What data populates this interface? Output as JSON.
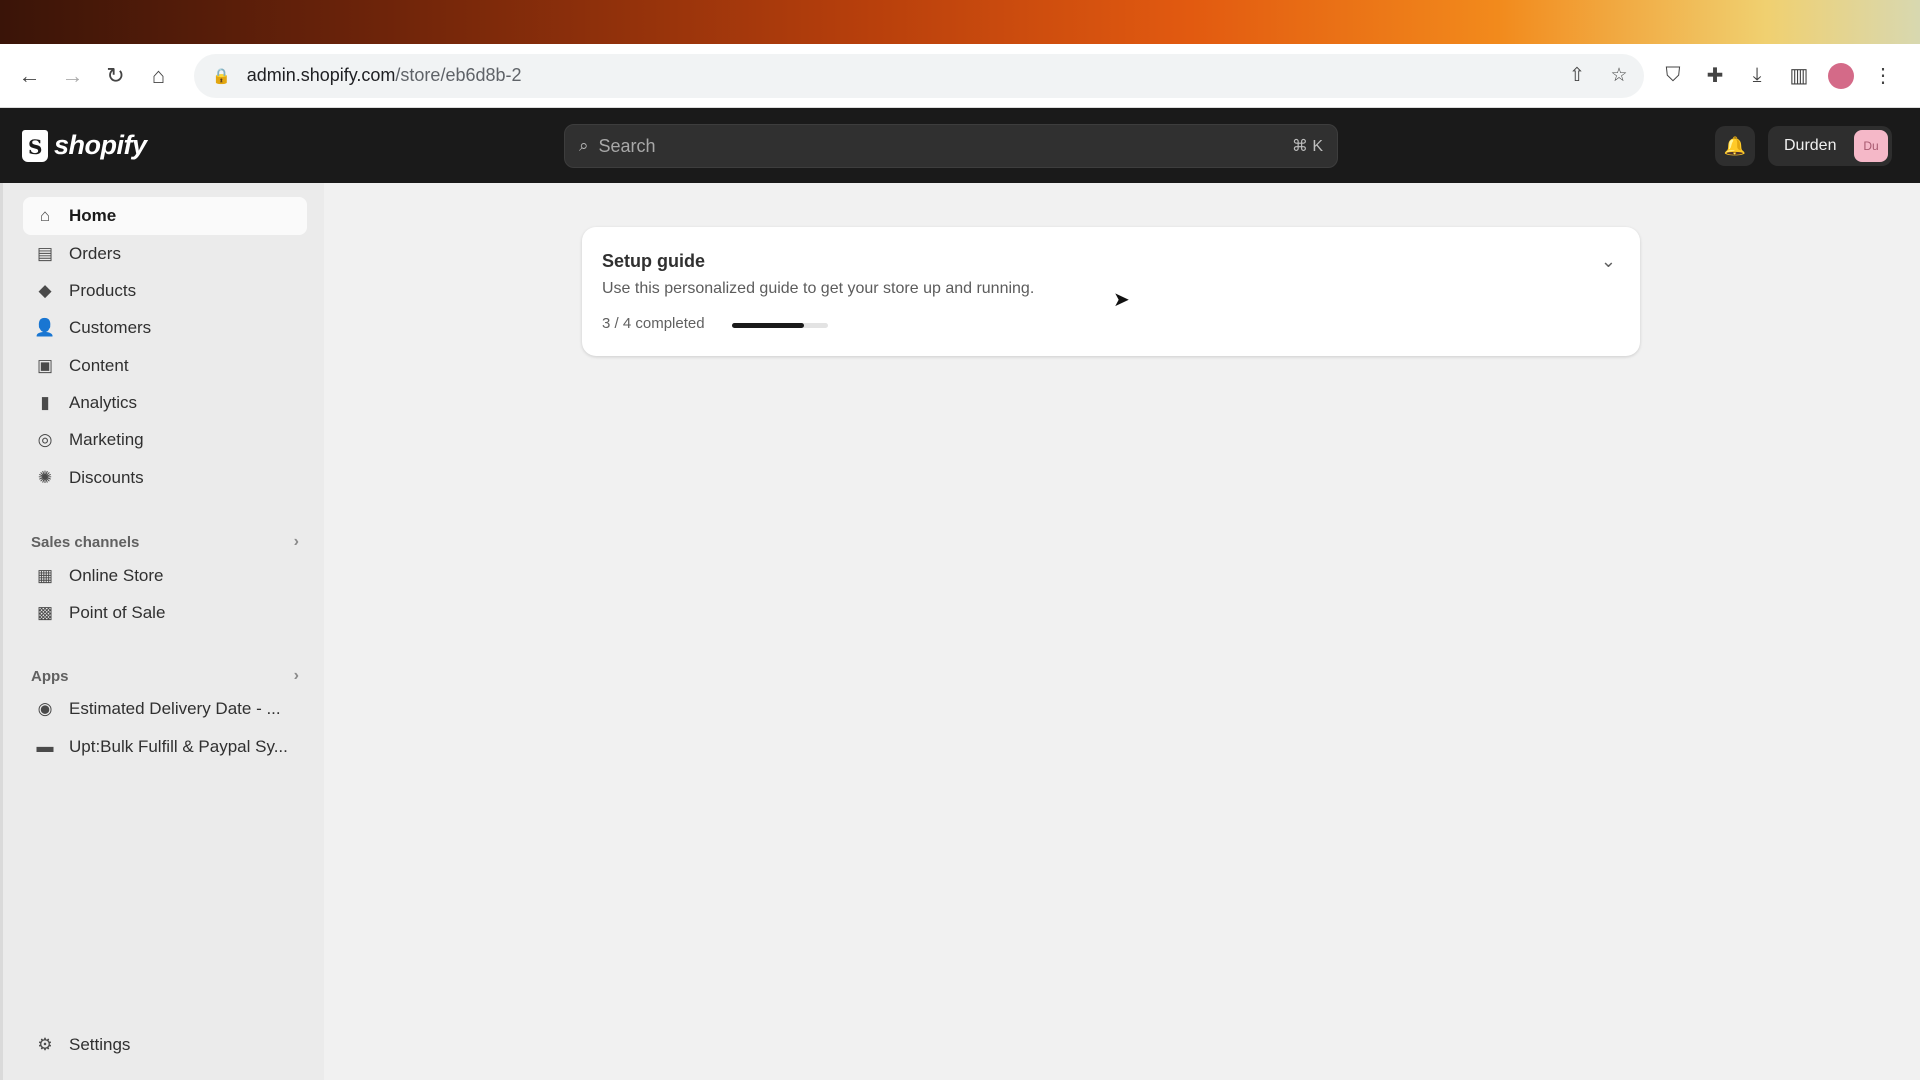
{
  "browser": {
    "url_host": "admin.shopify.com",
    "url_path": "/store/eb6d8b-2",
    "nav_icons": [
      "back-arrow-icon",
      "forward-arrow-icon",
      "reload-icon",
      "home-icon"
    ],
    "omnibox_icons": [
      "share-icon",
      "star-icon"
    ],
    "toolbar_icons": [
      "shield-extension-icon",
      "puzzle-extensions-icon",
      "download-icon",
      "sidepanel-icon",
      "profile-avatar",
      "kebab-menu-icon"
    ]
  },
  "header": {
    "logo_text": "shopify",
    "search_placeholder": "Search",
    "search_shortcut": "⌘ K",
    "user_name": "Durden",
    "user_initials": "Du"
  },
  "sidebar": {
    "main_items": [
      {
        "label": "Home",
        "icon": "home-icon",
        "active": true
      },
      {
        "label": "Orders",
        "icon": "inbox-icon"
      },
      {
        "label": "Products",
        "icon": "tag-icon"
      },
      {
        "label": "Customers",
        "icon": "person-icon"
      },
      {
        "label": "Content",
        "icon": "content-icon"
      },
      {
        "label": "Analytics",
        "icon": "bar-chart-icon"
      },
      {
        "label": "Marketing",
        "icon": "target-icon"
      },
      {
        "label": "Discounts",
        "icon": "discount-icon"
      }
    ],
    "sales_channels_label": "Sales channels",
    "sales_channels": [
      {
        "label": "Online Store",
        "icon": "store-icon"
      },
      {
        "label": "Point of Sale",
        "icon": "pos-icon"
      }
    ],
    "apps_label": "Apps",
    "apps": [
      {
        "label": "Estimated Delivery Date - ...",
        "icon": "app-icon"
      },
      {
        "label": "Upt:Bulk Fulfill & Paypal Sy...",
        "icon": "app-icon"
      }
    ],
    "settings_label": "Settings"
  },
  "setup_guide": {
    "title": "Setup guide",
    "description": "Use this personalized guide to get your store up and running.",
    "progress_text": "3 / 4 completed",
    "progress_fraction": 0.75
  },
  "colors": {
    "header_bg": "#1a1a1a",
    "page_bg": "#f1f1f1",
    "accent_pink": "#f5b8c8"
  }
}
